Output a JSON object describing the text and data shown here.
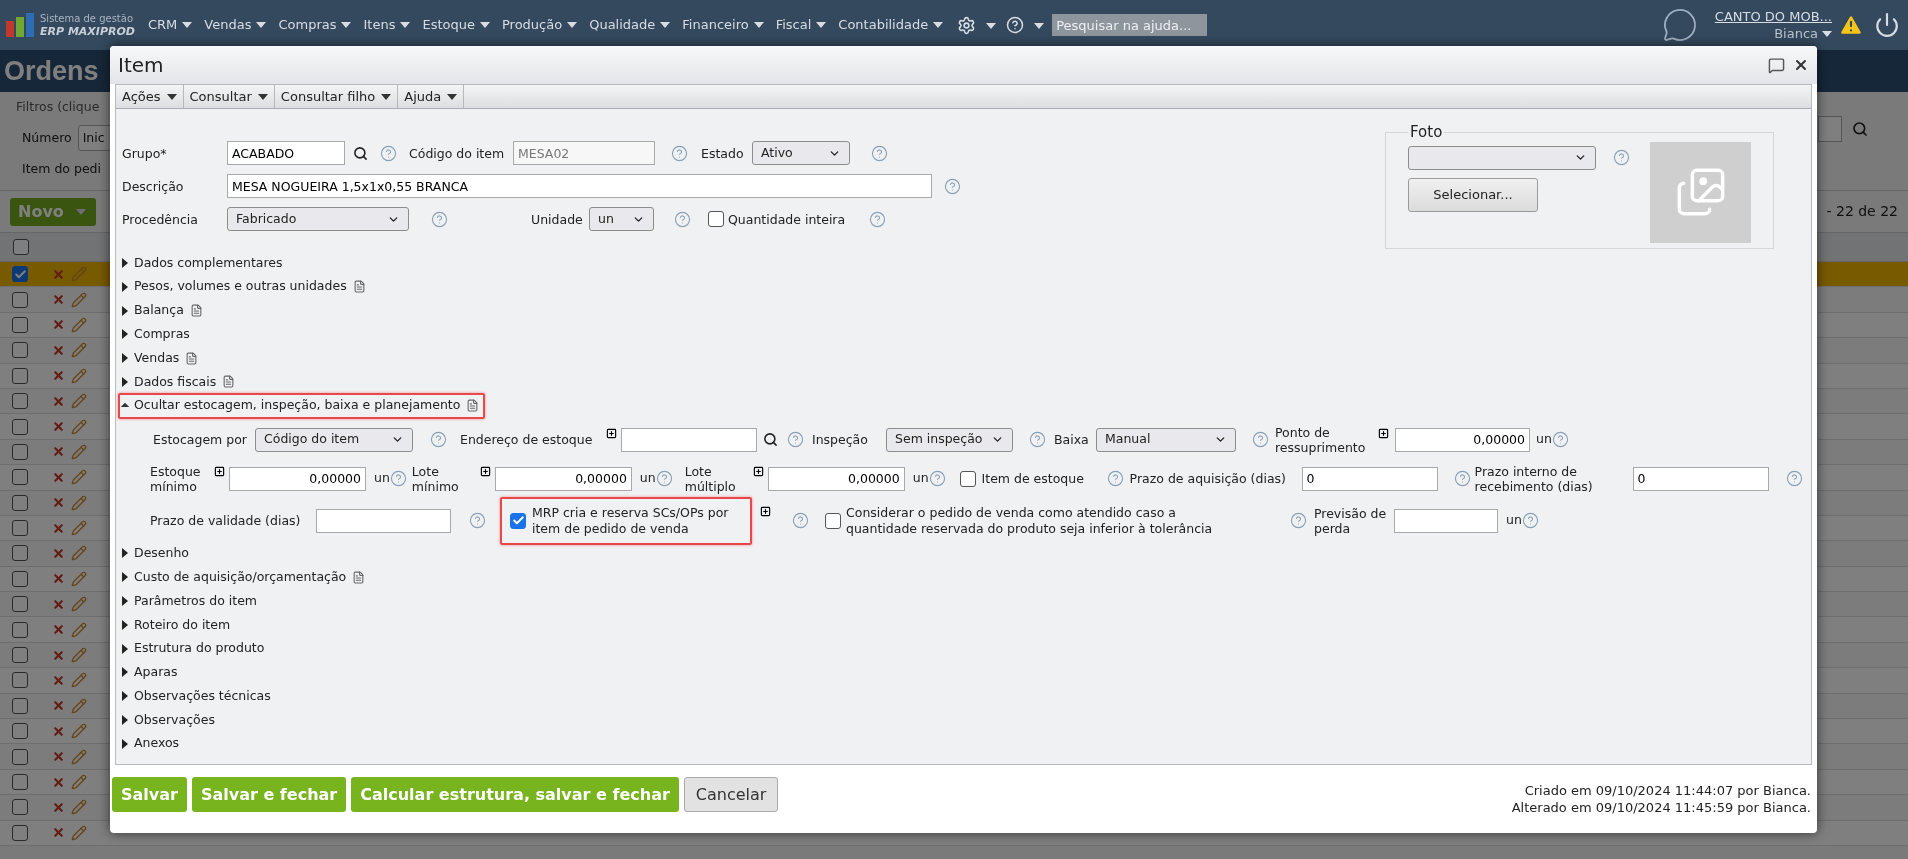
{
  "top_nav": {
    "logo_line1": "Sistema de gestão",
    "logo_line2": "ERP MAXIPROD",
    "menus": [
      "CRM",
      "Vendas",
      "Compras",
      "Itens",
      "Estoque",
      "Produção",
      "Qualidade",
      "Financeiro",
      "Fiscal",
      "Contabilidade"
    ],
    "search_placeholder": "Pesquisar na ajuda...",
    "company": "CANTO DO MOB...",
    "user": "Bianca"
  },
  "background": {
    "title": "Ordens",
    "filters_legend": "Filtros (clique",
    "numero_label": "Número",
    "numero_value": "Inic",
    "item_label": "Item do pedi",
    "new_button": "Novo",
    "pager": "- 22 de 22",
    "header_checked": false,
    "rows": [
      {
        "selected": true
      },
      {
        "selected": false
      },
      {
        "selected": false
      },
      {
        "selected": false
      },
      {
        "selected": false
      },
      {
        "selected": false
      },
      {
        "selected": false
      },
      {
        "selected": false
      },
      {
        "selected": false
      },
      {
        "selected": false
      },
      {
        "selected": false
      },
      {
        "selected": false
      },
      {
        "selected": false
      },
      {
        "selected": false
      },
      {
        "selected": false
      },
      {
        "selected": false
      },
      {
        "selected": false
      },
      {
        "selected": false
      },
      {
        "selected": false
      },
      {
        "selected": false
      },
      {
        "selected": false
      },
      {
        "selected": false
      },
      {
        "selected": false
      }
    ]
  },
  "dialog": {
    "title": "Item",
    "toolbar": [
      "Ações",
      "Consultar",
      "Consultar filho",
      "Ajuda"
    ],
    "grupo": {
      "label": "Grupo*",
      "value": "ACABADO"
    },
    "codigo": {
      "label": "Código do item",
      "value": "MESA02",
      "disabled": true
    },
    "estado": {
      "label": "Estado",
      "value": "Ativo"
    },
    "descricao": {
      "label": "Descrição",
      "value": "MESA NOGUEIRA 1,5x1x0,55 BRANCA"
    },
    "procedencia": {
      "label": "Procedência",
      "value": "Fabricado"
    },
    "unidade": {
      "label": "Unidade",
      "value": "un"
    },
    "quantidade_inteira": {
      "label": "Quantidade inteira",
      "checked": false
    },
    "foto": {
      "legend": "Foto",
      "button": "Selecionar..."
    },
    "sections": [
      {
        "label": "Dados complementares",
        "expanded": false,
        "note": false,
        "highlighted": false
      },
      {
        "label": "Pesos, volumes e outras unidades",
        "expanded": false,
        "note": true,
        "highlighted": false
      },
      {
        "label": "Balança",
        "expanded": false,
        "note": true,
        "highlighted": false
      },
      {
        "label": "Compras",
        "expanded": false,
        "note": false,
        "highlighted": false
      },
      {
        "label": "Vendas",
        "expanded": false,
        "note": true,
        "highlighted": false
      },
      {
        "label": "Dados fiscais",
        "expanded": false,
        "note": true,
        "highlighted": false
      },
      {
        "label": "Ocultar estocagem, inspeção, baixa e planejamento",
        "expanded": true,
        "note": true,
        "highlighted": true
      },
      {
        "label": "Desenho",
        "expanded": false,
        "note": false,
        "highlighted": false
      },
      {
        "label": "Custo de aquisição/orçamentação",
        "expanded": false,
        "note": true,
        "highlighted": false
      },
      {
        "label": "Parâmetros do item",
        "expanded": false,
        "note": false,
        "highlighted": false
      },
      {
        "label": "Roteiro do item",
        "expanded": false,
        "note": false,
        "highlighted": false
      },
      {
        "label": "Estrutura do produto",
        "expanded": false,
        "note": false,
        "highlighted": false
      },
      {
        "label": "Aparas",
        "expanded": false,
        "note": false,
        "highlighted": false
      },
      {
        "label": "Observações técnicas",
        "expanded": false,
        "note": false,
        "highlighted": false
      },
      {
        "label": "Observações",
        "expanded": false,
        "note": false,
        "highlighted": false
      },
      {
        "label": "Anexos",
        "expanded": false,
        "note": false,
        "highlighted": false
      }
    ],
    "stock": {
      "estocagem_por": {
        "label": "Estocagem por",
        "value": "Código do item"
      },
      "endereco": {
        "label": "Endereço de estoque"
      },
      "inspecao": {
        "label": "Inspeção",
        "value": "Sem inspeção"
      },
      "baixa": {
        "label": "Baixa",
        "value": "Manual"
      },
      "ponto": {
        "label": "Ponto de ressuprimento",
        "value": "0,00000",
        "unit": "un"
      },
      "estoque_minimo": {
        "label": "Estoque mínimo",
        "value": "0,00000",
        "unit": "un"
      },
      "lote_minimo": {
        "label": "Lote mínimo",
        "value": "0,00000",
        "unit": "un"
      },
      "lote_multiplo": {
        "label": "Lote múltiplo",
        "value": "0,00000",
        "unit": "un"
      },
      "item_de_estoque": {
        "label": "Item de estoque",
        "checked": false
      },
      "prazo_aquisicao": {
        "label": "Prazo de aquisição (dias)",
        "value": "0"
      },
      "prazo_interno": {
        "label": "Prazo interno de recebimento (dias)",
        "value": "0"
      },
      "prazo_validade": {
        "label": "Prazo de validade (dias)"
      },
      "mrp": {
        "label": "MRP cria e reserva SCs/OPs por item de pedido de venda",
        "checked": true,
        "highlighted": true
      },
      "considerar": {
        "label": "Considerar o pedido de venda como atendido caso a quantidade reservada do produto seja inferior à tolerância",
        "checked": false
      },
      "previsao": {
        "label": "Previsão de perda",
        "unit": "un"
      }
    },
    "buttons": [
      {
        "label": "Salvar",
        "kind": "primary"
      },
      {
        "label": "Salvar e fechar",
        "kind": "primary"
      },
      {
        "label": "Calcular estrutura, salvar e fechar",
        "kind": "primary"
      },
      {
        "label": "Cancelar",
        "kind": "secondary"
      }
    ],
    "created": "Criado em 09/10/2024 11:44:07 por Bianca.",
    "modified": "Alterado em 09/10/2024 11:45:59 por Bianca."
  }
}
